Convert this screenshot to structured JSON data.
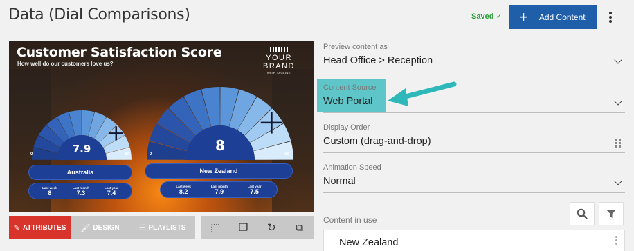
{
  "header": {
    "title": "Data (Dial Comparisons)",
    "saved_label": "Saved",
    "saved_icon": "check-icon",
    "add_button_label": "Add Content"
  },
  "preview": {
    "title": "Customer Satisfaction Score",
    "subtitle": "How well do our customers love us?",
    "brand_name": "YOUR BRAND",
    "brand_tagline": "WITH TAGLINE",
    "dials": [
      {
        "value": "7.9",
        "min": "0",
        "max": "10",
        "label": "Australia",
        "stats": [
          {
            "label": "Last week",
            "value": "8"
          },
          {
            "label": "Last month",
            "value": "7.3"
          },
          {
            "label": "Last year",
            "value": "7.4"
          }
        ]
      },
      {
        "value": "8",
        "min": "0",
        "max": "10",
        "label": "New Zealand",
        "stats": [
          {
            "label": "Last week",
            "value": "8.2"
          },
          {
            "label": "Last month",
            "value": "7.9"
          },
          {
            "label": "Last year",
            "value": "7.5"
          }
        ]
      }
    ]
  },
  "toolbar": {
    "attributes": "ATTRIBUTES",
    "design": "DESIGN",
    "playlists": "PLAYLISTS"
  },
  "form": {
    "preview_as": {
      "label": "Preview content as",
      "value": "Head Office > Reception"
    },
    "content_source": {
      "label": "Content Source",
      "value": "Web Portal"
    },
    "display_order": {
      "label": "Display Order",
      "value": "Custom (drag-and-drop)"
    },
    "animation_speed": {
      "label": "Animation Speed",
      "value": "Normal"
    },
    "content_in_use": {
      "label": "Content in use",
      "items": [
        "New Zealand"
      ]
    }
  },
  "colors": {
    "primary": "#1f5ea8",
    "accent_red": "#d9342b",
    "highlight": "#5ec6c9",
    "saved_green": "#2a9d3a"
  }
}
